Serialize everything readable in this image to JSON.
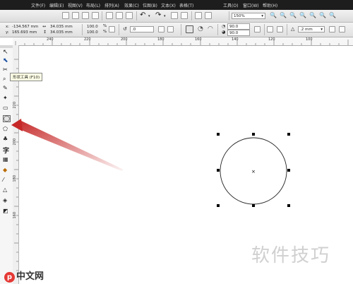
{
  "menu": [
    "文件(F)",
    "编辑(E)",
    "视图(V)",
    "布局(L)",
    "排列(A)",
    "效果(C)",
    "位图(B)",
    "文本(X)",
    "表格(T)",
    "工具(O)",
    "窗口(W)",
    "帮助(H)"
  ],
  "toolbar": {
    "zoom_value": "150%"
  },
  "properties": {
    "x_label": "x:",
    "x_value": "-134.567 mm",
    "y_label": "y:",
    "y_value": "165.693 mm",
    "width_value": "34.035 mm",
    "height_value": "34.035 mm",
    "scale_w": "100.0",
    "scale_h": "100.0",
    "scale_unit": "%",
    "rotation": ".0",
    "start_angle": "90.0",
    "end_angle": "90.0",
    "outline_width": ".2 mm"
  },
  "ruler": {
    "h_ticks": [
      "240",
      "220",
      "200",
      "180",
      "160",
      "140",
      "120",
      "100"
    ],
    "v_ticks": [
      "220",
      "200",
      "180",
      "160"
    ]
  },
  "tooltip": "形状工具 (F10)",
  "watermark": {
    "text": "软件技巧",
    "logo_text": "中文网",
    "logo_letter": "p"
  },
  "colors": {
    "menubar": "#1d1d1d",
    "arrow": "#c0392b",
    "canvas": "#ffffff"
  }
}
